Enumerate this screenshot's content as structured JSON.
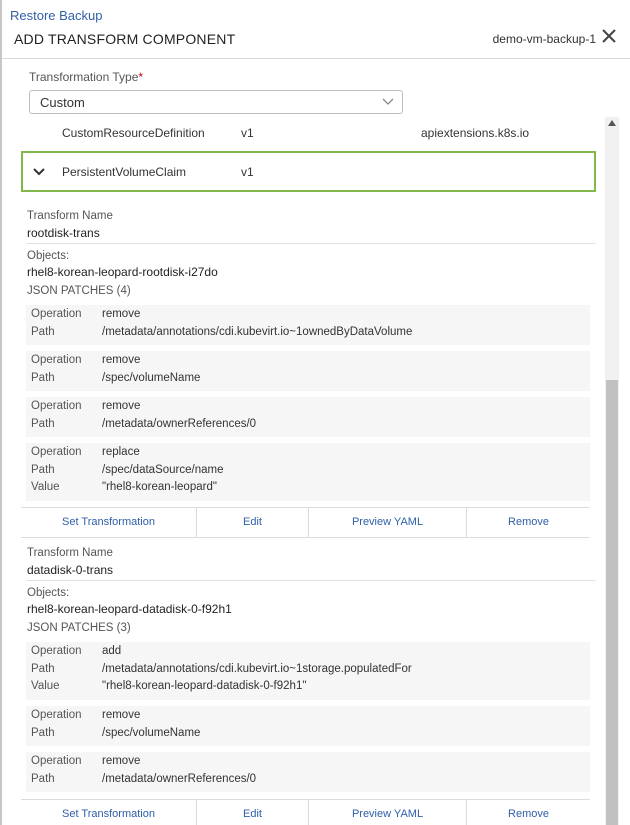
{
  "header": {
    "breadcrumb": "Restore Backup",
    "title": "ADD TRANSFORM COMPONENT",
    "vm_name": "demo-vm-backup-1"
  },
  "transformation_type": {
    "label": "Transformation Type",
    "required_mark": "*",
    "value": "Custom"
  },
  "resources": [
    {
      "kind": "CustomResourceDefinition",
      "version": "v1",
      "group": "apiextensions.k8s.io"
    },
    {
      "kind": "PersistentVolumeClaim",
      "version": "v1",
      "group": ""
    }
  ],
  "labels": {
    "transform_name": "Transform Name",
    "objects": "Objects:",
    "operation": "Operation",
    "path": "Path",
    "value": "Value"
  },
  "transforms": [
    {
      "name": "rootdisk-trans",
      "object": "rhel8-korean-leopard-rootdisk-i27do",
      "patches_title": "JSON PATCHES (4)",
      "patches": [
        {
          "operation": "remove",
          "path": "/metadata/annotations/cdi.kubevirt.io~1ownedByDataVolume"
        },
        {
          "operation": "remove",
          "path": "/spec/volumeName"
        },
        {
          "operation": "remove",
          "path": "/metadata/ownerReferences/0"
        },
        {
          "operation": "replace",
          "path": "/spec/dataSource/name",
          "value": "\"rhel8-korean-leopard\""
        }
      ],
      "actions": [
        "Set Transformation",
        "Edit",
        "Preview YAML",
        "Remove"
      ]
    },
    {
      "name": "datadisk-0-trans",
      "object": "rhel8-korean-leopard-datadisk-0-f92h1",
      "patches_title": "JSON PATCHES (3)",
      "patches": [
        {
          "operation": "add",
          "path": "/metadata/annotations/cdi.kubevirt.io~1storage.populatedFor",
          "value": "\"rhel8-korean-leopard-datadisk-0-f92h1\""
        },
        {
          "operation": "remove",
          "path": "/spec/volumeName"
        },
        {
          "operation": "remove",
          "path": "/metadata/ownerReferences/0"
        }
      ],
      "actions": [
        "Set Transformation",
        "Edit",
        "Preview YAML",
        "Remove"
      ]
    }
  ],
  "colors": {
    "link": "#2f5fa8",
    "expanded_border": "#82b84a",
    "required": "#d0021b"
  }
}
